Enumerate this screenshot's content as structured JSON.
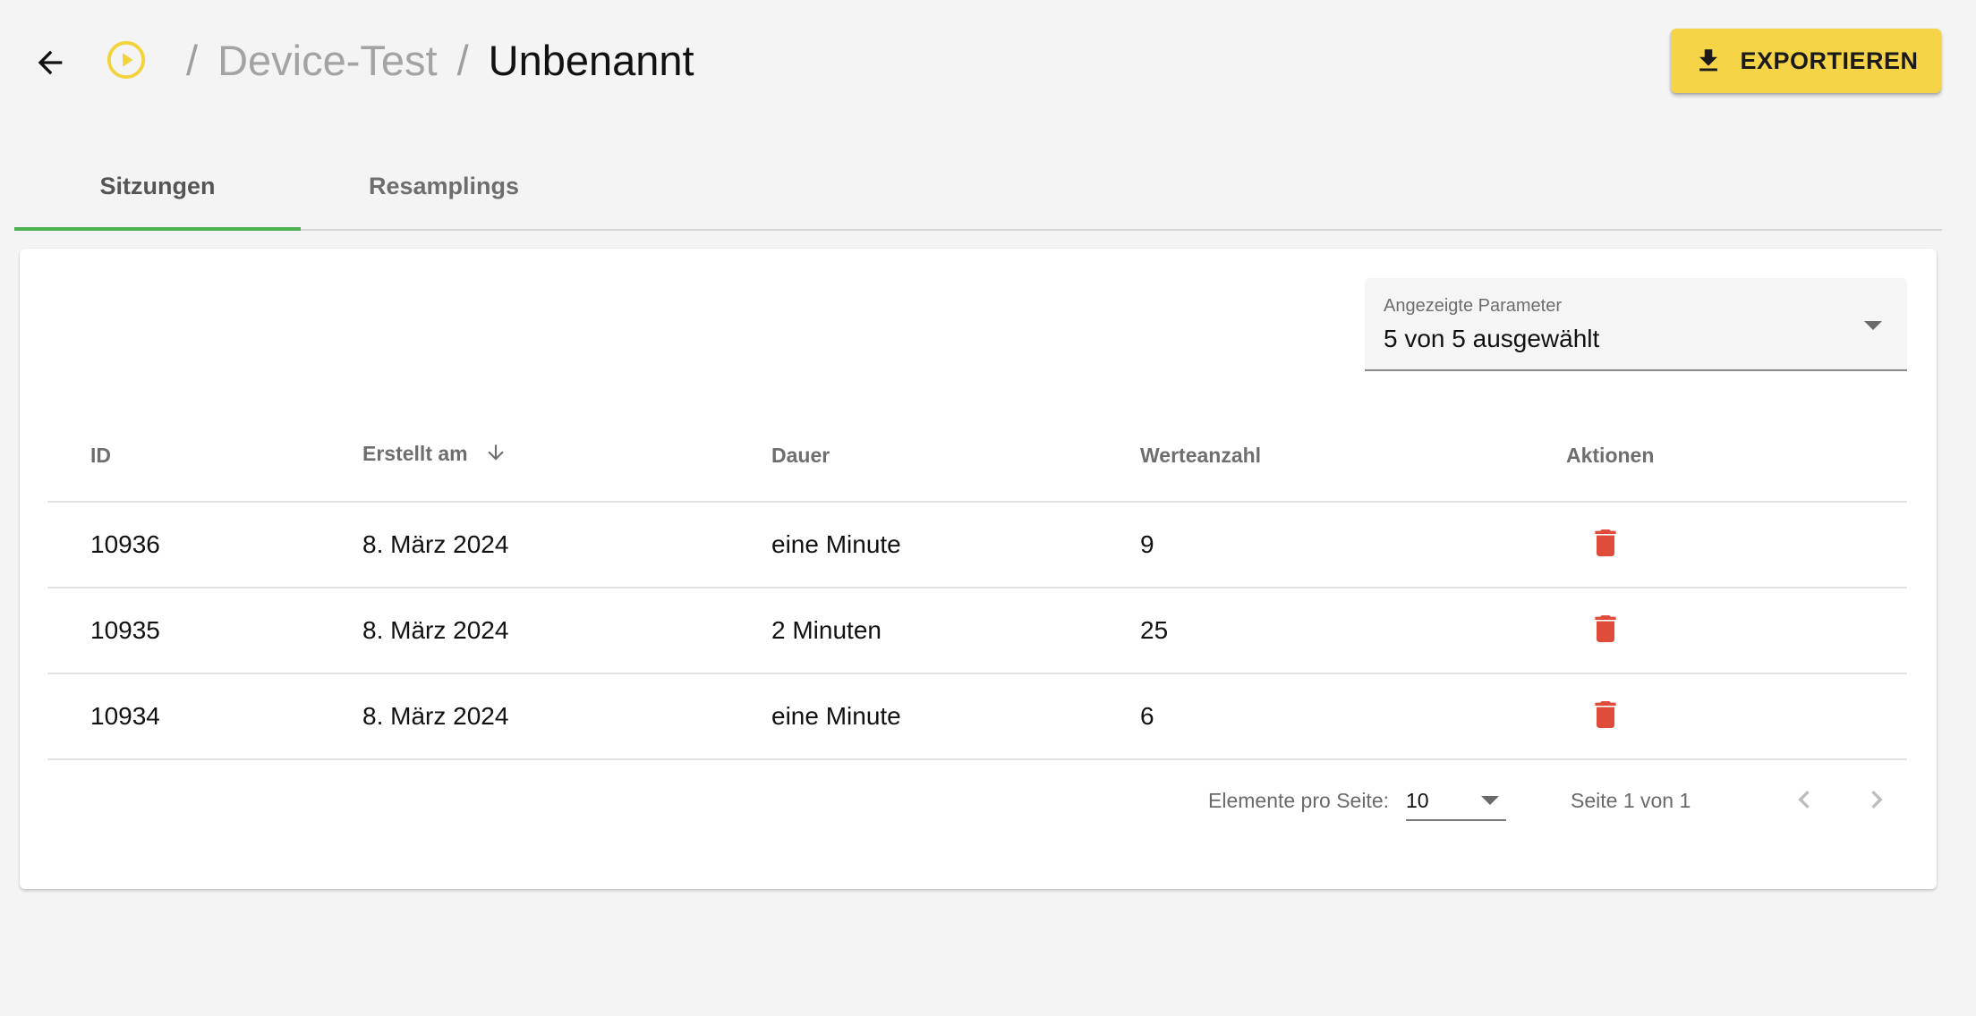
{
  "header": {
    "breadcrumb_parent": "Device-Test",
    "breadcrumb_current": "Unbenannt",
    "separator": "/",
    "export_label": "EXPORTIEREN"
  },
  "tabs": [
    {
      "label": "Sitzungen",
      "active": true
    },
    {
      "label": "Resamplings",
      "active": false
    }
  ],
  "parameter_select": {
    "label": "Angezeigte Parameter",
    "value": "5 von 5 ausgewählt"
  },
  "table": {
    "columns": [
      "ID",
      "Erstellt am",
      "Dauer",
      "Werteanzahl",
      "Aktionen"
    ],
    "rows": [
      {
        "id": "10936",
        "created": "8. März 2024",
        "duration": "eine Minute",
        "count": "9"
      },
      {
        "id": "10935",
        "created": "8. März 2024",
        "duration": "2 Minuten",
        "count": "25"
      },
      {
        "id": "10934",
        "created": "8. März 2024",
        "duration": "eine Minute",
        "count": "6"
      }
    ]
  },
  "pagination": {
    "items_per_page_label": "Elemente pro Seite:",
    "items_per_page_value": "10",
    "page_info": "Seite 1 von 1"
  },
  "colors": {
    "accent_yellow": "#f5d448",
    "tab_indicator": "#4caf50",
    "delete_red": "#e04c3a",
    "play_icon": "#f2d33b"
  },
  "icons": {
    "back": "arrow-left-icon",
    "play": "play-circle-icon",
    "export": "download-icon",
    "sort": "arrow-down-icon",
    "delete": "trash-icon",
    "prev": "chevron-left-icon",
    "next": "chevron-right-icon"
  }
}
